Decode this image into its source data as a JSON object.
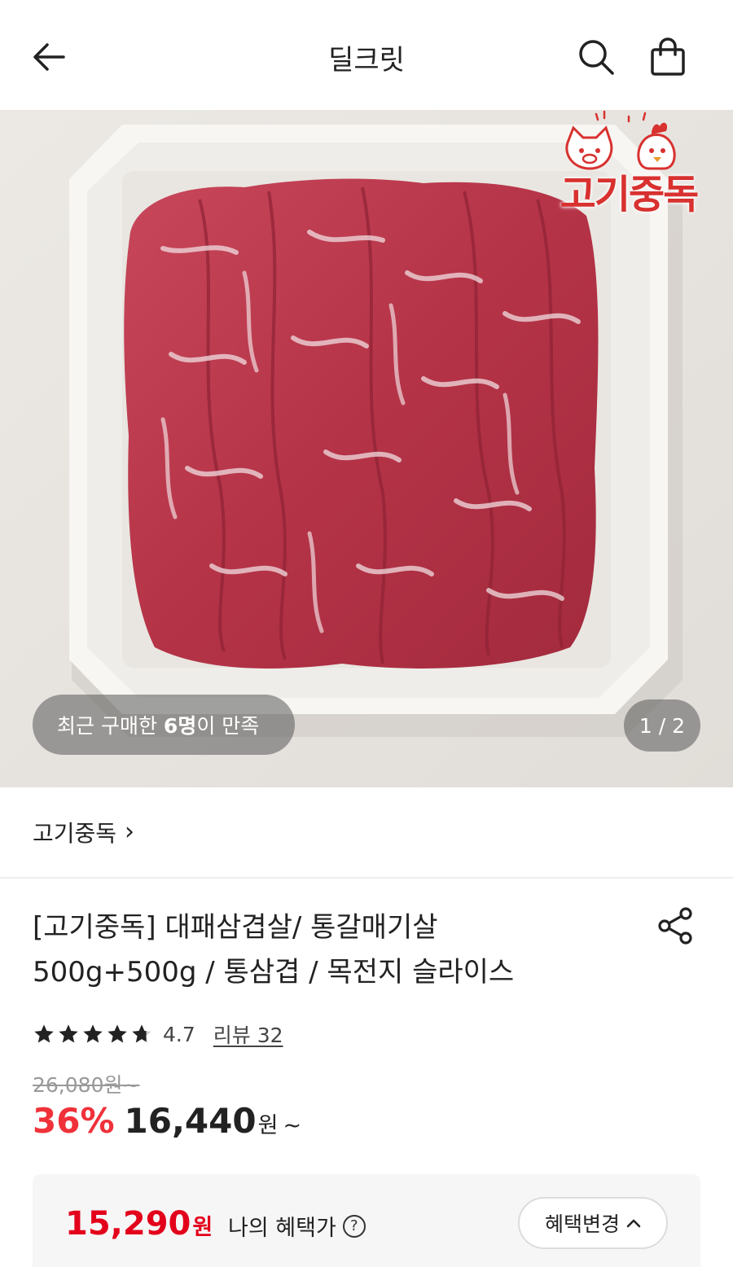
{
  "header": {
    "title": "딜크릿",
    "icons": [
      "back-arrow-icon",
      "search-icon",
      "shopping-bag-icon"
    ]
  },
  "hero": {
    "logo_text": "고기중독",
    "satisfy_prefix": "최근 구매한 ",
    "satisfy_count": "6명",
    "satisfy_suffix": "이 만족",
    "counter": "1 / 2"
  },
  "seller": {
    "name": "고기중독",
    "chevron": "›"
  },
  "product": {
    "title_line1": "[고기중독] 대패삼겹살/ 통갈매기살",
    "title_line2": "500g+500g / 통삼겹 / 목전지 슬라이스",
    "rating": "4.7",
    "rating_value": 4.7,
    "review_link": "리뷰 32",
    "original_price": "26,080원~",
    "discount": "36%",
    "sale_price": "16,440",
    "price_unit": "원",
    "price_tilde": "~"
  },
  "benefit": {
    "price": "15,290",
    "unit": "원",
    "label": "나의 혜택가",
    "help_icon": "?",
    "change_button": "혜택변경",
    "change_chevron": "^"
  },
  "colors": {
    "accent_red": "#f0313a",
    "benefit_red": "#e3001b",
    "logo_red": "#d8312f"
  }
}
